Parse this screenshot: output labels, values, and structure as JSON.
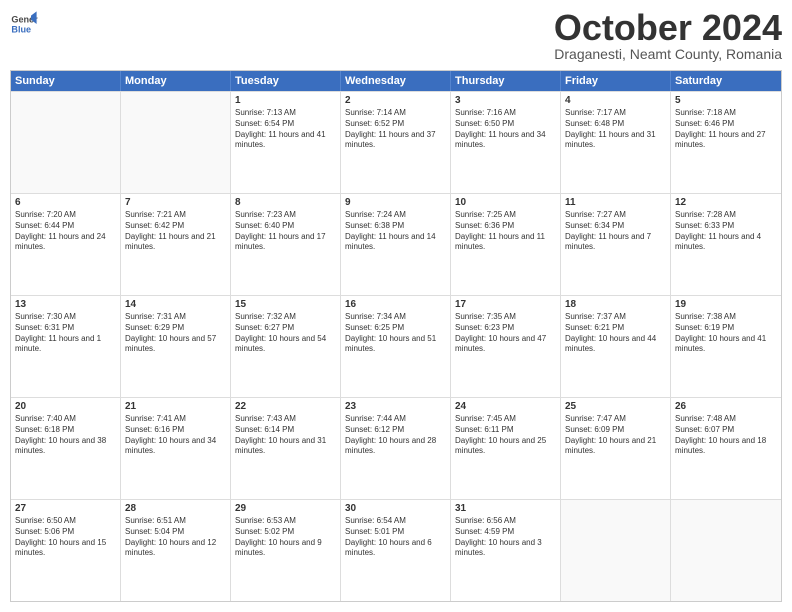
{
  "header": {
    "logo_line1": "General",
    "logo_line2": "Blue",
    "month": "October 2024",
    "location": "Draganesti, Neamt County, Romania"
  },
  "days": [
    "Sunday",
    "Monday",
    "Tuesday",
    "Wednesday",
    "Thursday",
    "Friday",
    "Saturday"
  ],
  "rows": [
    [
      {
        "day": "",
        "text": "",
        "empty": true
      },
      {
        "day": "",
        "text": "",
        "empty": true
      },
      {
        "day": "1",
        "text": "Sunrise: 7:13 AM\nSunset: 6:54 PM\nDaylight: 11 hours and 41 minutes."
      },
      {
        "day": "2",
        "text": "Sunrise: 7:14 AM\nSunset: 6:52 PM\nDaylight: 11 hours and 37 minutes."
      },
      {
        "day": "3",
        "text": "Sunrise: 7:16 AM\nSunset: 6:50 PM\nDaylight: 11 hours and 34 minutes."
      },
      {
        "day": "4",
        "text": "Sunrise: 7:17 AM\nSunset: 6:48 PM\nDaylight: 11 hours and 31 minutes."
      },
      {
        "day": "5",
        "text": "Sunrise: 7:18 AM\nSunset: 6:46 PM\nDaylight: 11 hours and 27 minutes."
      }
    ],
    [
      {
        "day": "6",
        "text": "Sunrise: 7:20 AM\nSunset: 6:44 PM\nDaylight: 11 hours and 24 minutes."
      },
      {
        "day": "7",
        "text": "Sunrise: 7:21 AM\nSunset: 6:42 PM\nDaylight: 11 hours and 21 minutes."
      },
      {
        "day": "8",
        "text": "Sunrise: 7:23 AM\nSunset: 6:40 PM\nDaylight: 11 hours and 17 minutes."
      },
      {
        "day": "9",
        "text": "Sunrise: 7:24 AM\nSunset: 6:38 PM\nDaylight: 11 hours and 14 minutes."
      },
      {
        "day": "10",
        "text": "Sunrise: 7:25 AM\nSunset: 6:36 PM\nDaylight: 11 hours and 11 minutes."
      },
      {
        "day": "11",
        "text": "Sunrise: 7:27 AM\nSunset: 6:34 PM\nDaylight: 11 hours and 7 minutes."
      },
      {
        "day": "12",
        "text": "Sunrise: 7:28 AM\nSunset: 6:33 PM\nDaylight: 11 hours and 4 minutes."
      }
    ],
    [
      {
        "day": "13",
        "text": "Sunrise: 7:30 AM\nSunset: 6:31 PM\nDaylight: 11 hours and 1 minute."
      },
      {
        "day": "14",
        "text": "Sunrise: 7:31 AM\nSunset: 6:29 PM\nDaylight: 10 hours and 57 minutes."
      },
      {
        "day": "15",
        "text": "Sunrise: 7:32 AM\nSunset: 6:27 PM\nDaylight: 10 hours and 54 minutes."
      },
      {
        "day": "16",
        "text": "Sunrise: 7:34 AM\nSunset: 6:25 PM\nDaylight: 10 hours and 51 minutes."
      },
      {
        "day": "17",
        "text": "Sunrise: 7:35 AM\nSunset: 6:23 PM\nDaylight: 10 hours and 47 minutes."
      },
      {
        "day": "18",
        "text": "Sunrise: 7:37 AM\nSunset: 6:21 PM\nDaylight: 10 hours and 44 minutes."
      },
      {
        "day": "19",
        "text": "Sunrise: 7:38 AM\nSunset: 6:19 PM\nDaylight: 10 hours and 41 minutes."
      }
    ],
    [
      {
        "day": "20",
        "text": "Sunrise: 7:40 AM\nSunset: 6:18 PM\nDaylight: 10 hours and 38 minutes."
      },
      {
        "day": "21",
        "text": "Sunrise: 7:41 AM\nSunset: 6:16 PM\nDaylight: 10 hours and 34 minutes."
      },
      {
        "day": "22",
        "text": "Sunrise: 7:43 AM\nSunset: 6:14 PM\nDaylight: 10 hours and 31 minutes."
      },
      {
        "day": "23",
        "text": "Sunrise: 7:44 AM\nSunset: 6:12 PM\nDaylight: 10 hours and 28 minutes."
      },
      {
        "day": "24",
        "text": "Sunrise: 7:45 AM\nSunset: 6:11 PM\nDaylight: 10 hours and 25 minutes."
      },
      {
        "day": "25",
        "text": "Sunrise: 7:47 AM\nSunset: 6:09 PM\nDaylight: 10 hours and 21 minutes."
      },
      {
        "day": "26",
        "text": "Sunrise: 7:48 AM\nSunset: 6:07 PM\nDaylight: 10 hours and 18 minutes."
      }
    ],
    [
      {
        "day": "27",
        "text": "Sunrise: 6:50 AM\nSunset: 5:06 PM\nDaylight: 10 hours and 15 minutes."
      },
      {
        "day": "28",
        "text": "Sunrise: 6:51 AM\nSunset: 5:04 PM\nDaylight: 10 hours and 12 minutes."
      },
      {
        "day": "29",
        "text": "Sunrise: 6:53 AM\nSunset: 5:02 PM\nDaylight: 10 hours and 9 minutes."
      },
      {
        "day": "30",
        "text": "Sunrise: 6:54 AM\nSunset: 5:01 PM\nDaylight: 10 hours and 6 minutes."
      },
      {
        "day": "31",
        "text": "Sunrise: 6:56 AM\nSunset: 4:59 PM\nDaylight: 10 hours and 3 minutes."
      },
      {
        "day": "",
        "text": "",
        "empty": true
      },
      {
        "day": "",
        "text": "",
        "empty": true
      }
    ]
  ]
}
